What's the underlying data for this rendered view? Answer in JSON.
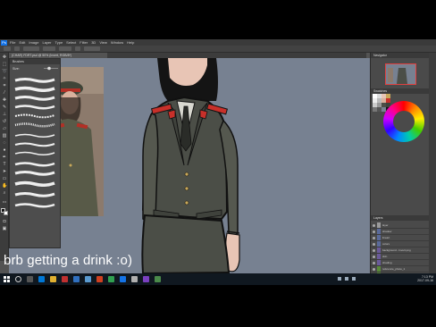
{
  "menubar": {
    "logo": "Ps",
    "items": [
      "File",
      "Edit",
      "Image",
      "Layer",
      "Type",
      "Select",
      "Filter",
      "3D",
      "View",
      "Window",
      "Help"
    ]
  },
  "document": {
    "tab_title": "(CHAR) FDRT.psd @ 50% (Invert, RGB/8*)"
  },
  "brushes_panel": {
    "title": "Brushes",
    "size_label": "Size:"
  },
  "navigator_panel": {
    "title": "Navigator"
  },
  "swatches_panel": {
    "title": "Swatches"
  },
  "layers_panel": {
    "title": "Layers",
    "rows": [
      "layer",
      "shadow",
      "lineart",
      "colors",
      "background - Invert.png",
      "skin",
      "shading",
      "reference_photo_1",
      "base",
      "sketch",
      "notes_blackout",
      "reference_frame"
    ]
  },
  "statusbar": {
    "text": "Doc: 10.2M/388.4M"
  },
  "caption": {
    "text": "brb getting a drink :o)"
  },
  "taskbar": {
    "time": "7:13 PM",
    "date": "2017-09-16"
  },
  "colors": {
    "canvas_bg": "#778191",
    "uniform": "#4b4e47",
    "accent_red": "#c8302a",
    "ps_blue": "#1473e6"
  }
}
